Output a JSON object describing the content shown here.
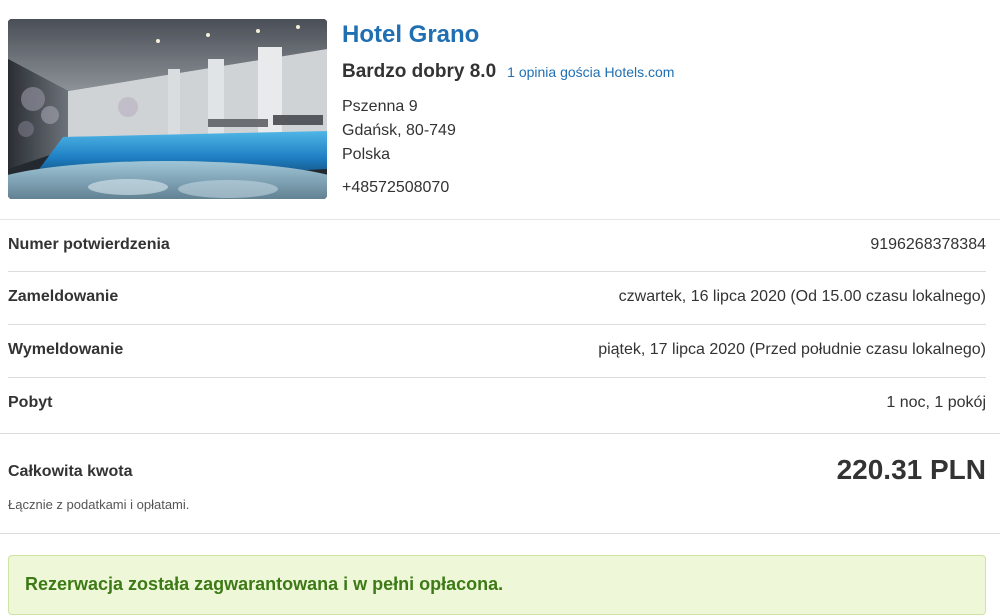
{
  "hotel": {
    "name": "Hotel Grano",
    "rating": "Bardzo dobry 8.0",
    "reviews_link": "1 opinia gościa Hotels.com",
    "address": {
      "street": "Pszenna 9",
      "city": "Gdańsk, 80-749",
      "country": "Polska"
    },
    "phone": "+48572508070",
    "photo_icon": "hotel-pool-photo"
  },
  "details": [
    {
      "label": "Numer potwierdzenia",
      "value": "9196268378384"
    },
    {
      "label": "Zameldowanie",
      "value": "czwartek, 16 lipca 2020 (Od 15.00 czasu lokalnego)"
    },
    {
      "label": "Wymeldowanie",
      "value": "piątek, 17 lipca 2020 (Przed południe czasu lokalnego)"
    },
    {
      "label": "Pobyt",
      "value": "1 noc, 1 pokój"
    }
  ],
  "total": {
    "label": "Całkowita kwota",
    "amount": "220.31 PLN",
    "note": "Łącznie z podatkami i opłatami."
  },
  "banner": {
    "text": "Rezerwacja została zagwarantowana i w pełni opłacona."
  },
  "colors": {
    "link": "#1f6fb2",
    "success_text": "#3d7a16",
    "success_bg": "#eef8d8"
  }
}
